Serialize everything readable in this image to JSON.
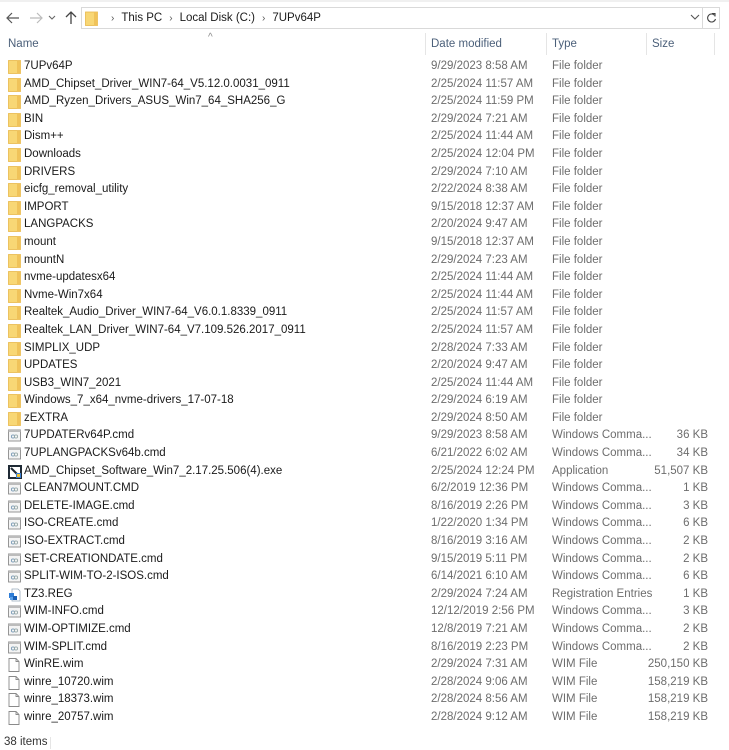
{
  "navigation": {
    "back_icon": "arrow-left-icon",
    "forward_icon": "arrow-right-icon",
    "recent_icon": "chevron-down-icon",
    "up_icon": "arrow-up-icon",
    "refresh_icon": "refresh-icon"
  },
  "address_bar": {
    "breadcrumbs": [
      "This PC",
      "Local Disk (C:)",
      "7UPv64P"
    ]
  },
  "columns": {
    "name": "Name",
    "date_modified": "Date modified",
    "type": "Type",
    "size": "Size",
    "sort_indicator": "^"
  },
  "files": [
    {
      "name": "7UPv64P",
      "date": "9/29/2023 8:58 AM",
      "type": "File folder",
      "size": "",
      "icon": "folder"
    },
    {
      "name": "AMD_Chipset_Driver_WIN7-64_V5.12.0.0031_0911",
      "date": "2/25/2024 11:57 AM",
      "type": "File folder",
      "size": "",
      "icon": "folder"
    },
    {
      "name": "AMD_Ryzen_Drivers_ASUS_Win7_64_SHA256_G",
      "date": "2/25/2024 11:59 PM",
      "type": "File folder",
      "size": "",
      "icon": "folder"
    },
    {
      "name": "BIN",
      "date": "2/29/2024 7:21 AM",
      "type": "File folder",
      "size": "",
      "icon": "folder"
    },
    {
      "name": "Dism++",
      "date": "2/25/2024 11:44 AM",
      "type": "File folder",
      "size": "",
      "icon": "folder"
    },
    {
      "name": "Downloads",
      "date": "2/25/2024 12:04 PM",
      "type": "File folder",
      "size": "",
      "icon": "folder"
    },
    {
      "name": "DRIVERS",
      "date": "2/29/2024 7:10 AM",
      "type": "File folder",
      "size": "",
      "icon": "folder"
    },
    {
      "name": "eicfg_removal_utility",
      "date": "2/22/2024 8:38 AM",
      "type": "File folder",
      "size": "",
      "icon": "folder"
    },
    {
      "name": "IMPORT",
      "date": "9/15/2018 12:37 AM",
      "type": "File folder",
      "size": "",
      "icon": "folder"
    },
    {
      "name": "LANGPACKS",
      "date": "2/20/2024 9:47 AM",
      "type": "File folder",
      "size": "",
      "icon": "folder"
    },
    {
      "name": "mount",
      "date": "9/15/2018 12:37 AM",
      "type": "File folder",
      "size": "",
      "icon": "folder"
    },
    {
      "name": "mountN",
      "date": "2/29/2024 7:23 AM",
      "type": "File folder",
      "size": "",
      "icon": "folder"
    },
    {
      "name": "nvme-updatesx64",
      "date": "2/25/2024 11:44 AM",
      "type": "File folder",
      "size": "",
      "icon": "folder"
    },
    {
      "name": "Nvme-Win7x64",
      "date": "2/25/2024 11:44 AM",
      "type": "File folder",
      "size": "",
      "icon": "folder"
    },
    {
      "name": "Realtek_Audio_Driver_WIN7-64_V6.0.1.8339_0911",
      "date": "2/25/2024 11:57 AM",
      "type": "File folder",
      "size": "",
      "icon": "folder"
    },
    {
      "name": "Realtek_LAN_Driver_WIN7-64_V7.109.526.2017_0911",
      "date": "2/25/2024 11:57 AM",
      "type": "File folder",
      "size": "",
      "icon": "folder"
    },
    {
      "name": "SIMPLIX_UDP",
      "date": "2/28/2024 7:33 AM",
      "type": "File folder",
      "size": "",
      "icon": "folder"
    },
    {
      "name": "UPDATES",
      "date": "2/20/2024 9:47 AM",
      "type": "File folder",
      "size": "",
      "icon": "folder"
    },
    {
      "name": "USB3_WIN7_2021",
      "date": "2/25/2024 11:44 AM",
      "type": "File folder",
      "size": "",
      "icon": "folder"
    },
    {
      "name": "Windows_7_x64_nvme-drivers_17-07-18",
      "date": "2/29/2024 6:19 AM",
      "type": "File folder",
      "size": "",
      "icon": "folder"
    },
    {
      "name": "zEXTRA",
      "date": "2/29/2024 8:50 AM",
      "type": "File folder",
      "size": "",
      "icon": "folder"
    },
    {
      "name": "7UPDATERv64P.cmd",
      "date": "9/29/2023 8:58 AM",
      "type": "Windows Comma...",
      "size": "36 KB",
      "icon": "cmd"
    },
    {
      "name": "7UPLANGPACKSv64b.cmd",
      "date": "6/21/2022 6:02 AM",
      "type": "Windows Comma...",
      "size": "34 KB",
      "icon": "cmd"
    },
    {
      "name": "AMD_Chipset_Software_Win7_2.17.25.506(4).exe",
      "date": "2/25/2024 12:24 PM",
      "type": "Application",
      "size": "51,507 KB",
      "icon": "exe"
    },
    {
      "name": "CLEAN7MOUNT.CMD",
      "date": "6/2/2019 12:36 PM",
      "type": "Windows Comma...",
      "size": "1 KB",
      "icon": "cmd"
    },
    {
      "name": "DELETE-IMAGE.cmd",
      "date": "8/16/2019 2:26 PM",
      "type": "Windows Comma...",
      "size": "3 KB",
      "icon": "cmd"
    },
    {
      "name": "ISO-CREATE.cmd",
      "date": "1/22/2020 1:34 PM",
      "type": "Windows Comma...",
      "size": "6 KB",
      "icon": "cmd"
    },
    {
      "name": "ISO-EXTRACT.cmd",
      "date": "8/16/2019 3:16 AM",
      "type": "Windows Comma...",
      "size": "2 KB",
      "icon": "cmd"
    },
    {
      "name": "SET-CREATIONDATE.cmd",
      "date": "9/15/2019 5:11 PM",
      "type": "Windows Comma...",
      "size": "2 KB",
      "icon": "cmd"
    },
    {
      "name": "SPLIT-WIM-TO-2-ISOS.cmd",
      "date": "6/14/2021 6:10 AM",
      "type": "Windows Comma...",
      "size": "6 KB",
      "icon": "cmd"
    },
    {
      "name": "TZ3.REG",
      "date": "2/29/2024 7:24 AM",
      "type": "Registration Entries",
      "size": "1 KB",
      "icon": "reg"
    },
    {
      "name": "WIM-INFO.cmd",
      "date": "12/12/2019 2:56 PM",
      "type": "Windows Comma...",
      "size": "3 KB",
      "icon": "cmd"
    },
    {
      "name": "WIM-OPTIMIZE.cmd",
      "date": "12/8/2019 7:21 AM",
      "type": "Windows Comma...",
      "size": "2 KB",
      "icon": "cmd"
    },
    {
      "name": "WIM-SPLIT.cmd",
      "date": "8/16/2019 2:23 PM",
      "type": "Windows Comma...",
      "size": "2 KB",
      "icon": "cmd"
    },
    {
      "name": "WinRE.wim",
      "date": "2/29/2024 7:31 AM",
      "type": "WIM File",
      "size": "250,150 KB",
      "icon": "file"
    },
    {
      "name": "winre_10720.wim",
      "date": "2/28/2024 9:06 AM",
      "type": "WIM File",
      "size": "158,219 KB",
      "icon": "file"
    },
    {
      "name": "winre_18373.wim",
      "date": "2/28/2024 8:56 AM",
      "type": "WIM File",
      "size": "158,219 KB",
      "icon": "file"
    },
    {
      "name": "winre_20757.wim",
      "date": "2/28/2024 9:12 AM",
      "type": "WIM File",
      "size": "158,219 KB",
      "icon": "file"
    }
  ],
  "status_bar": {
    "item_count": "38 items"
  },
  "colors": {
    "folder": "#f8d775",
    "folder_dark": "#e8b84a",
    "header_text": "#4c607a",
    "secondary_text": "#6d6d6d"
  }
}
